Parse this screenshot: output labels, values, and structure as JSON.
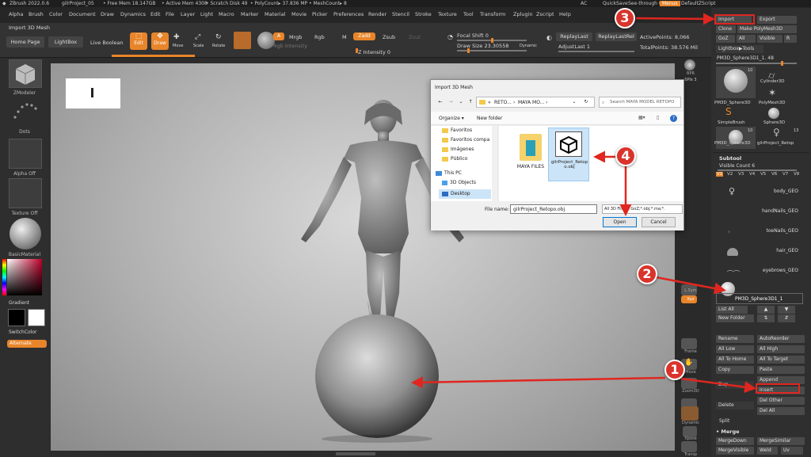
{
  "titlebar": {
    "app": "ZBrush 2022.0.6",
    "project": "gilrProject_05",
    "free_mem": "• Free Mem 18.147GB",
    "active_mem": "• Active Mem 4308",
    "scratch": "• Scratch Disk 49",
    "polycount": "• PolyCount▸ 37.836 MP",
    "meshcount": "• MeshCount▸ 8",
    "ac": "AC",
    "quicksave": "QuickSave",
    "seethrough": "See-through 0",
    "menus": "Menus",
    "defaultzscript": "DefaultZScript"
  },
  "menubar": [
    "Alpha",
    "Brush",
    "Color",
    "Document",
    "Draw",
    "Dynamics",
    "Edit",
    "File",
    "Layer",
    "Light",
    "Macro",
    "Marker",
    "Material",
    "Movie",
    "Picker",
    "Preferences",
    "Render",
    "Stencil",
    "Stroke",
    "Texture",
    "Tool",
    "Transform",
    "Zplugin",
    "Zscript",
    "Help"
  ],
  "toolbar": {
    "context_title": "Import 3D Mesh",
    "home_page": "Home Page",
    "lightbox": "LightBox",
    "live_boolean": "Live Boolean",
    "edit": "Edit",
    "draw": "Draw",
    "move": "Move",
    "scale": "Scale",
    "rotate": "Rotate",
    "a_btn": "A",
    "mrgb": "Mrgb",
    "rgb": "Rgb",
    "m": "M",
    "zadd": "Zadd",
    "zsub": "Zsub",
    "zcut": "Zcut",
    "rgb_intensity": "Rgb Intensity",
    "z_intensity": "Z Intensity 0",
    "focal_shift": "Focal Shift 0",
    "draw_size": "Draw Size 23.30558",
    "dynamic": "Dynamic",
    "replay_last": "ReplayLast",
    "replay_last_rel": "ReplayLastRel",
    "adjust_last": "AdjustLast 1",
    "active_points": "ActivePoints: 8,066",
    "total_points": "TotalPoints: 38.576 Mil"
  },
  "leftpanel": {
    "zmodeler": "ZModeler",
    "dots": "Dots",
    "alpha_off": "Alpha Off",
    "texture_off": "Texture Off",
    "basic_material": "BasicMaterial",
    "gradient": "Gradient",
    "switch_color": "SwitchColor",
    "alternate": "Alternate"
  },
  "shelf": [
    "BPR",
    "SPix 3",
    "Persp",
    "Floor",
    "Local",
    "L.Sym",
    "Xyz",
    "Frame",
    "Move",
    "Zoom3D",
    "Rotate",
    "Line Fill",
    "Transp",
    "Solo",
    "Dynamic",
    "Xpose"
  ],
  "rightpanel": {
    "import": "Import",
    "export": "Export",
    "clone": "Clone",
    "make_polymesh": "Make PolyMesh3D",
    "goz": "GoZ",
    "all": "All",
    "visible": "Visible",
    "r": "R",
    "lightbox_tools": "Lightbox▶Tools",
    "current_tool": "PM3D_Sphere3D1_1. 48",
    "tools": [
      "PM3D_Sphere3D",
      "Cylinder3D",
      "PolyMesh3D",
      "SimpleBrush",
      "Sphere3D",
      "PM3D_Sphere3D",
      "gilrProject_Retop"
    ],
    "tool_counts": [
      "10",
      "10",
      "13"
    ],
    "subtool_header": "Subtool",
    "visible_count": "Visible Count 6",
    "versions": [
      "V1",
      "V2",
      "V3",
      "V4",
      "V5",
      "V6",
      "V7",
      "V8"
    ],
    "subtools": [
      "body_GEO",
      "handNails_GEO",
      "toeNails_GEO",
      "hair_GEO",
      "eyebrows_GEO",
      "PM3D_Sphere3D1_1"
    ],
    "list_all": "List All",
    "new_folder": "New Folder",
    "rename": "Rename",
    "autoreorder": "AutoReorder",
    "all_low": "All Low",
    "all_high": "All High",
    "all_to_home": "All To Home",
    "all_to_target": "All To Target",
    "copy": "Copy",
    "paste": "Paste",
    "append": "Append",
    "dup": "Dup",
    "insert": "Insert",
    "delete": "Delete",
    "del_other": "Del Other",
    "del_all": "Del All",
    "split": "Split",
    "merge": "Merge",
    "merge_down": "MergeDown",
    "merge_similar": "MergeSimilar",
    "merge_visible": "MergeVisible",
    "weld": "Weld",
    "uv": "Uv"
  },
  "dialog": {
    "title": "Import 3D Mesh",
    "path": [
      "«",
      "RETO...",
      "›",
      "MAYA MO...",
      "›"
    ],
    "search_placeholder": "Search MAYA MODEL RETOPO",
    "organize": "Organize ▾",
    "new_folder": "New folder",
    "nav": [
      "Favoritos",
      "Favoritos compa",
      "Imágenes",
      "Público",
      "This PC",
      "3D Objects",
      "Desktop"
    ],
    "files": [
      "MAYA FILES",
      "gilrProject_Retopo.obj"
    ],
    "file_name_label": "File name:",
    "file_name_value": "gilrProject_Retopo.obj",
    "file_type": "All 3D Files(*.GoZ;*.obj;*.ma;*.",
    "open": "Open",
    "cancel": "Cancel"
  },
  "annotations": [
    "1",
    "2",
    "3",
    "4"
  ],
  "colors": {
    "accent": "#e8852a",
    "annotation": "#d9342b"
  }
}
